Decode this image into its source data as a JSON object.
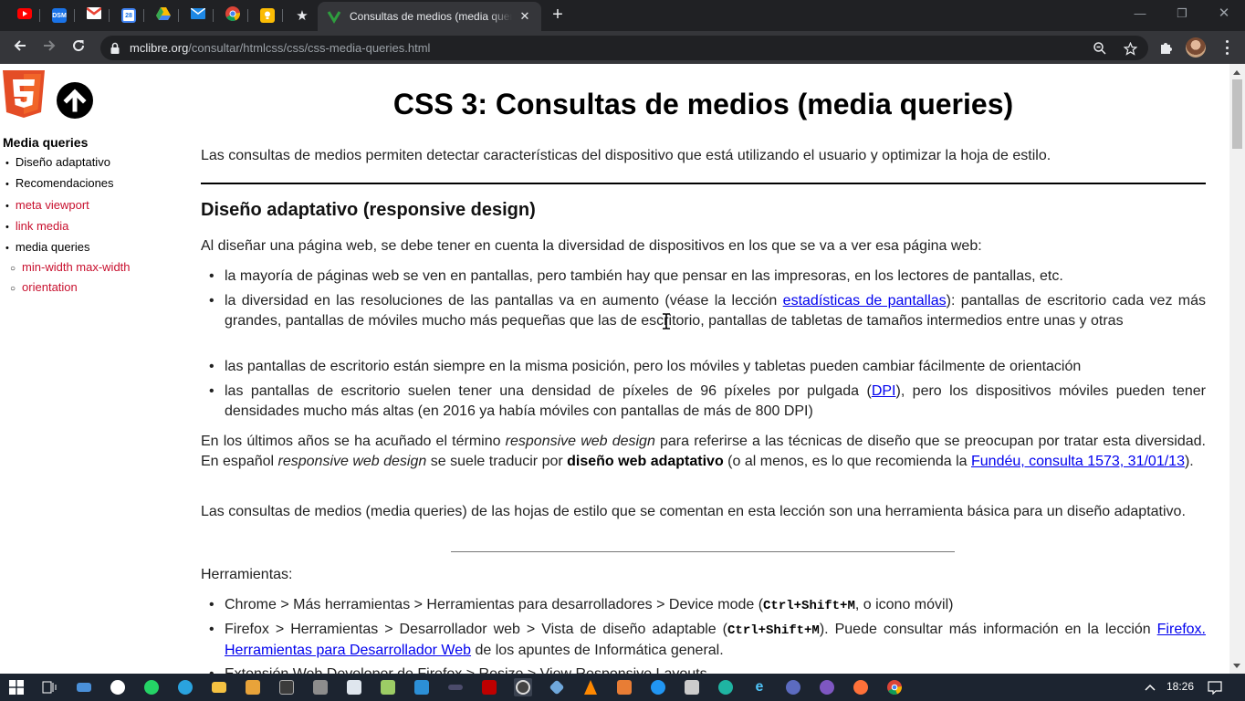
{
  "browser": {
    "active_tab_title": "Consultas de medios (media queries)",
    "url_host": "mclibre.org",
    "url_path": "/consultar/htmlcss/css/css-media-queries.html",
    "pinned_tabs": [
      "youtube-icon",
      "dsm-icon",
      "gmail-icon",
      "calendar-icon",
      "drive-icon",
      "mail-icon",
      "chrome-icon",
      "keep-icon",
      "star-icon"
    ],
    "pinned_labels": {
      "dsm": "DSM",
      "calendar": "28"
    }
  },
  "sidebar": {
    "title": "Media queries",
    "items": [
      {
        "label": "Diseño adaptativo",
        "style": "black"
      },
      {
        "label": "Recomendaciones",
        "style": "black"
      },
      {
        "label": "meta viewport",
        "style": "red"
      },
      {
        "label": "link media",
        "style": "red"
      },
      {
        "label": "media queries",
        "style": "black"
      },
      {
        "label": "min-width max-width",
        "style": "red"
      },
      {
        "label": "orientation",
        "style": "red"
      }
    ]
  },
  "page": {
    "title": "CSS 3: Consultas de medios (media queries)",
    "intro": "Las consultas de medios permiten detectar características del dispositivo que está utilizando el usuario y optimizar la hoja de estilo.",
    "section_title": "Diseño adaptativo (responsive design)",
    "p1": "Al diseñar una página web, se debe tener en cuenta la diversidad de dispositivos en los que se va a ver esa página web:",
    "b1": "la mayoría de páginas web se ven en pantallas, pero también hay que pensar en las impresoras, en los lectores de pantallas, etc.",
    "b2_a": "la diversidad en las resoluciones de las pantallas va en aumento (véase la lección ",
    "b2_link": "estadísticas de pantallas",
    "b2_b": "): pantallas de escritorio cada vez más grandes, pantallas de móviles mucho más pequeñas que las de escritorio, pantallas de tabletas de tamaños intermedios entre unas y otras",
    "b3": "las pantallas de escritorio están siempre en la misma posición, pero los móviles y tabletas pueden cambiar fácilmente de orientación",
    "b4_a": "las pantallas de escritorio suelen tener una densidad de píxeles de 96 píxeles por pulgada (",
    "b4_link": "DPI",
    "b4_b": "), pero los dispositivos móviles pueden tener densidades mucho más altas (en 2016 ya había móviles con pantallas de más de 800 DPI)",
    "p2_a": "En los últimos años se ha acuñado el término ",
    "p2_em1": "responsive web design",
    "p2_b": " para referirse a las técnicas de diseño que se preocupan por tratar esta diversidad. En español ",
    "p2_em2": "responsive web design",
    "p2_c": " se suele traducir por ",
    "p2_strong": "diseño web adaptativo",
    "p2_d": " (o al menos, es lo que recomienda la ",
    "p2_link": "Fundéu, consulta 1573, 31/01/13",
    "p2_e": ").",
    "p3": "Las consultas de medios (media queries) de las hojas de estilo que se comentan en esta lección son una herramienta básica para un diseño adaptativo.",
    "tools_label": "Herramientas:",
    "t1_a": "Chrome > Más herramientas > Herramientas para desarrolladores > Device mode (",
    "t1_kbd": "Ctrl+Shift+M",
    "t1_b": ", o icono móvil)",
    "t2_a": "Firefox > Herramientas > Desarrollador web > Vista de diseño adaptable (",
    "t2_kbd": "Ctrl+Shift+M",
    "t2_b": "). Puede consultar más información en la lección ",
    "t2_link": "Firefox. Herramientas para Desarrollador Web",
    "t2_c": " de los apuntes de Informática general.",
    "t3_partial": "Extensión Web Developer de Firefox > Resize > View Responsive Layouts"
  },
  "taskbar": {
    "clock": "18:26",
    "apps": [
      "file-explorer-icon",
      "whatsapp-icon",
      "telegram-icon",
      "folder-icon",
      "vscode-icon",
      "filezilla-icon",
      "obs-icon",
      "vlc-icon",
      "edge-icon",
      "firefox-icon",
      "chrome-icon"
    ]
  },
  "colors": {
    "sidebar_link": "#c8102e",
    "link": "#0000ee",
    "chrome_dark": "#202124",
    "chrome_toolbar": "#35363a",
    "taskbar": "#1c2430"
  }
}
